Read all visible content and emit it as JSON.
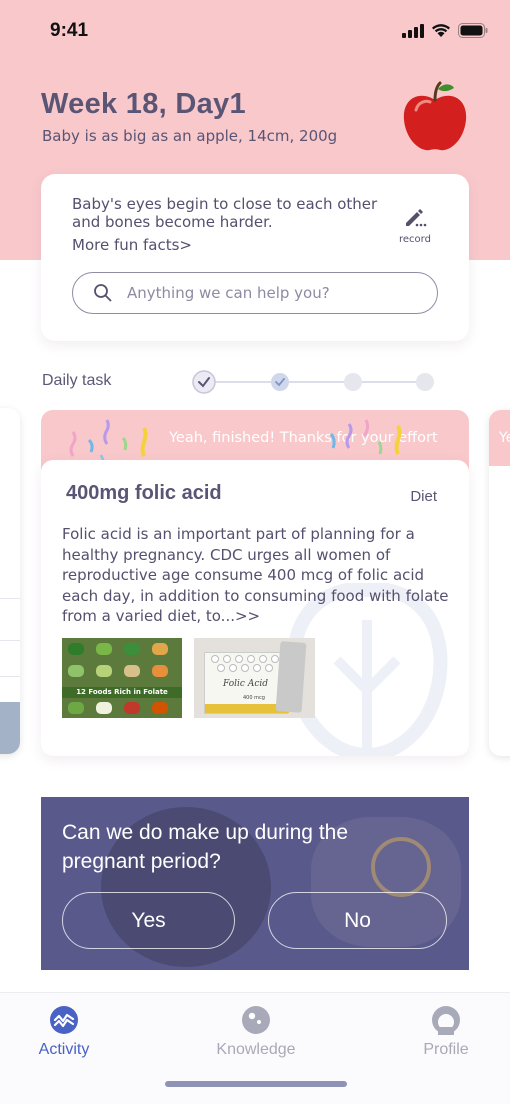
{
  "status_bar": {
    "time": "9:41"
  },
  "header": {
    "title": "Week 18, Day1",
    "subtitle": "Baby is as big as an apple, 14cm, 200g",
    "fruit_icon": "apple-icon"
  },
  "facts": {
    "text": "Baby's eyes begin to close to each other and bones become harder.",
    "more_link": "More fun facts>",
    "record_label": "record"
  },
  "search": {
    "placeholder": "Anything we can help you?"
  },
  "daily_task": {
    "label": "Daily task",
    "steps_total": 4,
    "steps_done": 2
  },
  "task_card": {
    "finished_banner": "Yeah, finished! Thanks for your effort",
    "title": "400mg folic acid",
    "tag": "Diet",
    "description": "Folic acid is an important part of planning for a healthy pregnancy. CDC urges all women of reproductive age consume 400 mcg of folic acid each day, in addition to consuming food with folate from a varied diet, to...>>",
    "image1_caption": "12 Foods Rich in Folate",
    "image2_caption": "Folic Acid",
    "image2_dose": "400 mcg"
  },
  "next_card": {
    "banner_fragment": "Yeah, she"
  },
  "question": {
    "text": "Can we do make up during the pregnant period?",
    "yes_label": "Yes",
    "no_label": "No"
  },
  "tabbar": {
    "tabs": [
      {
        "label": "Activity",
        "icon": "activity-icon",
        "active": true
      },
      {
        "label": "Knowledge",
        "icon": "knowledge-icon",
        "active": false
      },
      {
        "label": "Profile",
        "icon": "profile-icon",
        "active": false
      }
    ]
  },
  "colors": {
    "header_pink": "#f8c8cb",
    "text_primary": "#5a5575",
    "accent_blue": "#4a62c4",
    "question_bg": "#59598c"
  }
}
